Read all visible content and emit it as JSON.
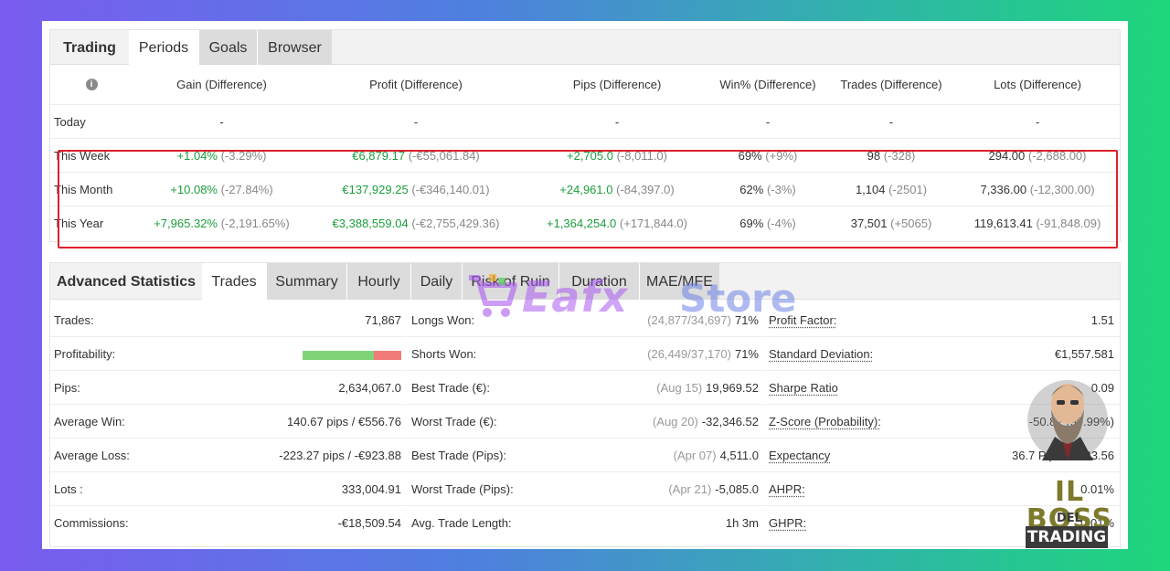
{
  "periods_tabs": [
    {
      "label": "Trading"
    },
    {
      "label": "Periods"
    },
    {
      "label": "Goals"
    },
    {
      "label": "Browser"
    }
  ],
  "periods_table": {
    "info_icon_glyph": "i",
    "headers": [
      "Gain (Difference)",
      "Profit (Difference)",
      "Pips (Difference)",
      "Win% (Difference)",
      "Trades (Difference)",
      "Lots (Difference)"
    ],
    "rows": [
      {
        "period": "Today",
        "gain": "-",
        "gain_diff": "",
        "profit": "-",
        "profit_diff": "",
        "pips": "-",
        "pips_diff": "",
        "win": "-",
        "win_diff": "",
        "trades": "-",
        "trades_diff": "",
        "lots": "-",
        "lots_diff": ""
      },
      {
        "period": "This Week",
        "gain": "+1.04%",
        "gain_diff": "(-3.29%)",
        "profit": "€6,879.17",
        "profit_diff": "(-€55,061.84)",
        "pips": "+2,705.0",
        "pips_diff": "(-8,011.0)",
        "win": "69%",
        "win_diff": "(+9%)",
        "trades": "98",
        "trades_diff": "(-328)",
        "lots": "294.00",
        "lots_diff": "(-2,688.00)"
      },
      {
        "period": "This Month",
        "gain": "+10.08%",
        "gain_diff": "(-27.84%)",
        "profit": "€137,929.25",
        "profit_diff": "(-€346,140.01)",
        "pips": "+24,961.0",
        "pips_diff": "(-84,397.0)",
        "win": "62%",
        "win_diff": "(-3%)",
        "trades": "1,104",
        "trades_diff": "(-2501)",
        "lots": "7,336.00",
        "lots_diff": "(-12,300.00)"
      },
      {
        "period": "This Year",
        "gain": "+7,965.32%",
        "gain_diff": "(-2,191.65%)",
        "profit": "€3,388,559.04",
        "profit_diff": "(-€2,755,429.36)",
        "pips": "+1,364,254.0",
        "pips_diff": "(+171,844.0)",
        "win": "69%",
        "win_diff": "(-4%)",
        "trades": "37,501",
        "trades_diff": "(+5065)",
        "lots": "119,613.41",
        "lots_diff": "(-91,848.09)"
      }
    ]
  },
  "stats_tabs": [
    {
      "label": "Advanced Statistics"
    },
    {
      "label": "Trades"
    },
    {
      "label": "Summary"
    },
    {
      "label": "Hourly"
    },
    {
      "label": "Daily"
    },
    {
      "label": "Risk of Ruin"
    },
    {
      "label": "Duration"
    },
    {
      "label": "MAE/MFE"
    }
  ],
  "stats": {
    "col1": [
      {
        "key": "Trades:",
        "value": "71,867"
      },
      {
        "key": "Profitability:",
        "value": "",
        "profitability_win_fraction": 0.72
      },
      {
        "key": "Pips:",
        "value": "2,634,067.0"
      },
      {
        "key": "Average Win:",
        "value": "140.67 pips / €556.76"
      },
      {
        "key": "Average Loss:",
        "value": "-223.27 pips / -€923.88"
      },
      {
        "key": "Lots :",
        "value": "333,004.91"
      },
      {
        "key": "Commissions:",
        "value": "-€18,509.54"
      }
    ],
    "col2": [
      {
        "key": "Longs Won:",
        "muted": "(24,877/34,697)",
        "value": "71%"
      },
      {
        "key": "Shorts Won:",
        "muted": "(26,449/37,170)",
        "value": "71%"
      },
      {
        "key": "Best Trade (€):",
        "muted": "(Aug 15)",
        "value": "19,969.52"
      },
      {
        "key": "Worst Trade (€):",
        "muted": "(Aug 20)",
        "value": "-32,346.52"
      },
      {
        "key": "Best Trade (Pips):",
        "muted": "(Apr 07)",
        "value": "4,511.0"
      },
      {
        "key": "Worst Trade (Pips):",
        "muted": "(Apr 21)",
        "value": "-5,085.0"
      },
      {
        "key": "Avg. Trade Length:",
        "muted": "",
        "value": "1h 3m"
      }
    ],
    "col3": [
      {
        "key": "Profit Factor:",
        "value": "1.51"
      },
      {
        "key": "Standard Deviation:",
        "value": "€1,557.581"
      },
      {
        "key": "Sharpe Ratio",
        "value": "0.09"
      },
      {
        "key": "Z-Score (Probability):",
        "value": "-50.82 (99.99%)"
      },
      {
        "key": "Expectancy",
        "value": "36.7 Pips / €133.56"
      },
      {
        "key": "AHPR:",
        "value": "0.01%"
      },
      {
        "key": "GHPR:",
        "value": "0.01%"
      }
    ]
  },
  "watermark": {
    "cart_icon": "shopping-cart",
    "brand_a": "Eafx",
    "brand_b": "Store"
  },
  "badge": {
    "line1": "IL BOSS",
    "line2": "DEL",
    "line3": "TRADING"
  },
  "colors": {
    "positive": "#1a9e3c",
    "highlight_border": "#e0202c",
    "bar_win": "#7fd47a",
    "bar_loss": "#f07b78"
  }
}
